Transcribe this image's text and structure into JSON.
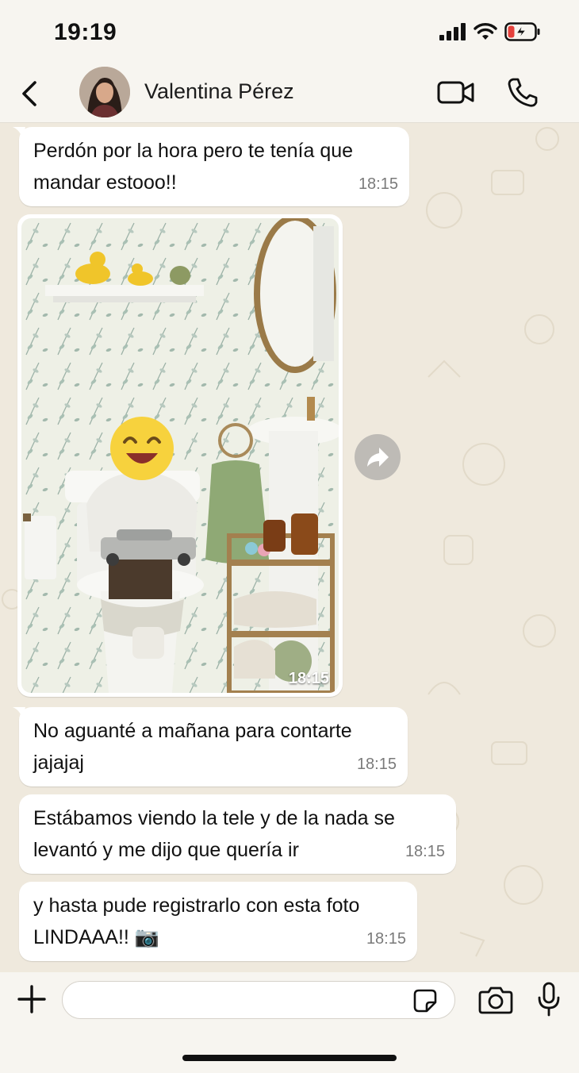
{
  "status_bar": {
    "time": "19:19"
  },
  "header": {
    "contact_name": "Valentina Pérez"
  },
  "messages": [
    {
      "text": "Perdón por la hora pero te tenía que\nmandar estooo!!",
      "time": "18:15"
    },
    {
      "type": "image",
      "time": "18:15",
      "description": "photo"
    },
    {
      "text": "No aguanté a mañana para contarte\njajajaj",
      "time": "18:15"
    },
    {
      "text": "Estábamos viendo la tele y de la nada se\nlevantó y me dijo que quería ir",
      "time": "18:15"
    },
    {
      "text": "y hasta pude registrarlo con esta foto\nLINDAAA!! 📷",
      "time": "18:15"
    }
  ],
  "input": {
    "placeholder": ""
  },
  "icons": {
    "back": "chevron-left-icon",
    "video": "video-camera-icon",
    "call": "phone-icon",
    "add": "plus-icon",
    "sticker": "sticker-icon",
    "camera": "camera-icon",
    "mic": "microphone-icon",
    "forward": "forward-icon"
  },
  "colors": {
    "bubble": "#ffffff",
    "chat_bg": "#efe9dd",
    "bar_bg": "#f7f5f0"
  }
}
